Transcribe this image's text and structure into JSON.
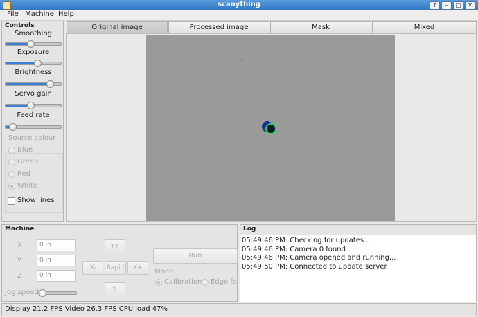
{
  "window": {
    "title": "scanything"
  },
  "menu": [
    {
      "label": "File"
    },
    {
      "label": "Machine"
    },
    {
      "label": "Help"
    }
  ],
  "controls": {
    "title": "Controls",
    "sliders": [
      {
        "label": "Smoothing",
        "value": 0.45
      },
      {
        "label": "Exposure",
        "value": 0.57
      },
      {
        "label": "Brightness",
        "value": 0.8
      },
      {
        "label": "Servo gain",
        "value": 0.45
      },
      {
        "label": "Feed rate",
        "value": 0.12
      }
    ],
    "source_colour": {
      "label": "Source colour",
      "options": [
        "Blue",
        "Green",
        "Red",
        "White"
      ],
      "selected": "White"
    },
    "show_lines": {
      "label": "Show lines",
      "checked": false
    }
  },
  "tabs": [
    {
      "label": "Original image",
      "active": true
    },
    {
      "label": "Processed image",
      "active": false
    },
    {
      "label": "Mask",
      "active": false
    },
    {
      "label": "Mixed",
      "active": false
    }
  ],
  "machine": {
    "title": "Machine",
    "x": {
      "label": "X",
      "value": "0 in"
    },
    "y": {
      "label": "Y",
      "value": "0 in"
    },
    "z": {
      "label": "Z",
      "value": "0 in"
    },
    "jog_speed_label": "Jog speed",
    "jog_speed": 0.1,
    "buttons": {
      "y_plus": "Y+",
      "x_minus": "X-",
      "rapid": "Rapid",
      "x_plus": "X+",
      "y_minus": "Y-"
    },
    "run": "Run",
    "mode": {
      "label": "Mode",
      "options": [
        "Calibration",
        "Edge follo"
      ],
      "selected": "Calibration"
    }
  },
  "log": {
    "title": "Log",
    "lines": [
      "05:49:46 PM: Checking for updates...",
      "05:49:46 PM: Camera 0 found",
      "05:49:46 PM: Camera opened and running...",
      "05:49:50 PM: Connected to update server"
    ]
  },
  "status": {
    "text": "Display 21.2 FPS Video 26.3 FPS CPU load 47%"
  },
  "colors": {
    "accent": "#3b7fd6",
    "titlebar": "#3c85cf"
  }
}
